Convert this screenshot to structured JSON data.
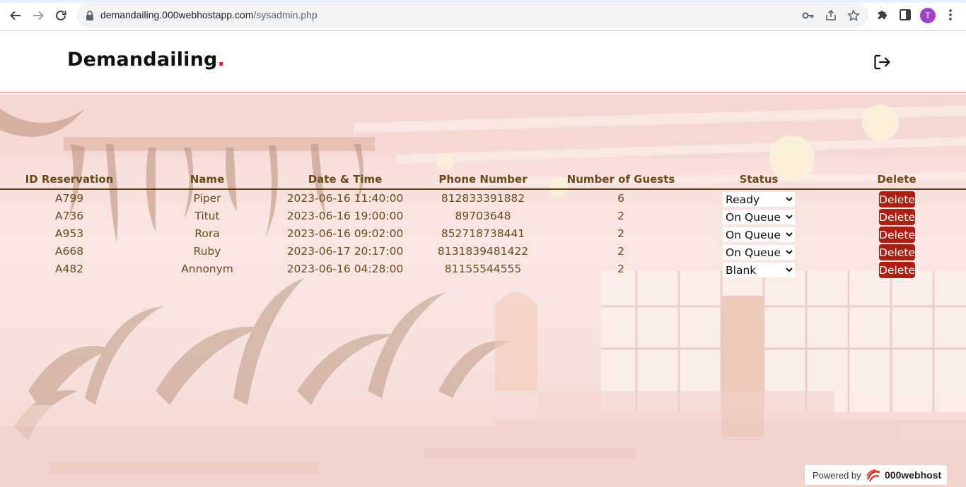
{
  "browser": {
    "url_domain": "demandailing.000webhostapp.com",
    "url_path": "/sysadmin.php",
    "profile_initial": "T"
  },
  "header": {
    "brand_name": "Demandailing",
    "brand_dot": ".",
    "brand_dot_color": "#e3141b"
  },
  "table": {
    "columns": [
      "ID Reservation",
      "Name",
      "Date & Time",
      "Phone Number",
      "Number of Guests",
      "Status",
      "Delete"
    ],
    "rows": [
      {
        "id": "A799",
        "name": "Piper",
        "datetime": "2023-06-16 11:40:00",
        "phone": "812833391882",
        "guests": "6",
        "status": "Ready",
        "action": "Delete"
      },
      {
        "id": "A736",
        "name": "Titut",
        "datetime": "2023-06-16 19:00:00",
        "phone": "89703648",
        "guests": "2",
        "status": "On Queue",
        "action": "Delete"
      },
      {
        "id": "A953",
        "name": "Rora",
        "datetime": "2023-06-16 09:02:00",
        "phone": "852718738441",
        "guests": "2",
        "status": "On Queue",
        "action": "Delete"
      },
      {
        "id": "A668",
        "name": "Ruby",
        "datetime": "2023-06-17 20:17:00",
        "phone": "8131839481422",
        "guests": "2",
        "status": "On Queue",
        "action": "Delete"
      },
      {
        "id": "A482",
        "name": "Annonym",
        "datetime": "2023-06-16 04:28:00",
        "phone": "81155544555",
        "guests": "2",
        "status": "Blank",
        "action": "Delete"
      }
    ]
  },
  "colors": {
    "header_text": "#6a4b17",
    "delete_button": "#ad1f12"
  },
  "footer_badge": {
    "powered_by": "Powered by",
    "brand": "000webhost"
  }
}
